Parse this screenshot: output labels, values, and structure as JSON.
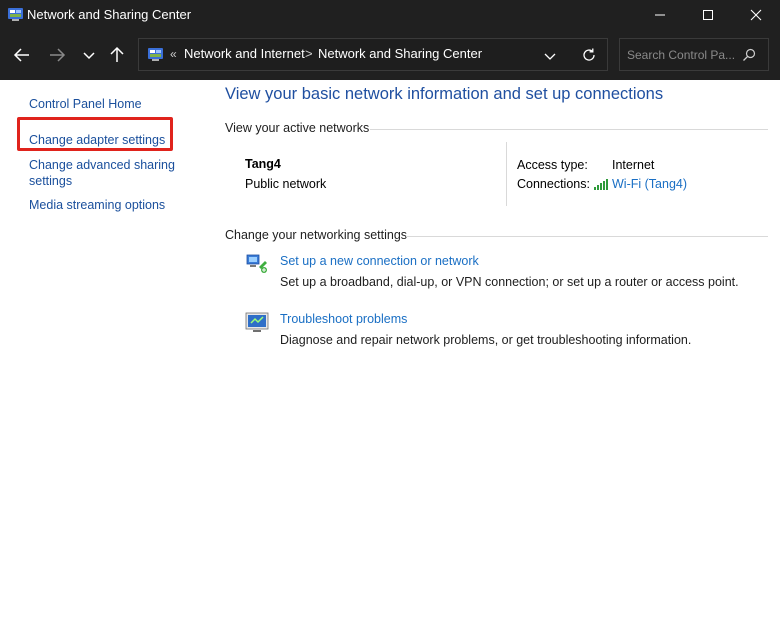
{
  "window": {
    "title": "Network and Sharing Center",
    "controls": [
      "minimize-icon",
      "maximize-icon",
      "close-icon"
    ]
  },
  "navigation": {
    "back_icon": "arrow-left-icon",
    "forward_icon": "arrow-right-icon",
    "recent_icon": "chevron-down-icon",
    "up_icon": "arrow-up-icon",
    "address": {
      "separator": "«",
      "crumbs": [
        "Network and Internet",
        "Network and Sharing Center"
      ],
      "crumb_separator": ">",
      "dropdown_icon": "chevron-down-icon",
      "refresh_icon": "refresh-icon"
    },
    "search": {
      "placeholder": "Search Control Pa...",
      "value": ""
    }
  },
  "sidebar": {
    "items": [
      {
        "label": "Control Panel Home"
      },
      {
        "label": "Change adapter settings",
        "highlighted": true
      },
      {
        "label": "Change advanced sharing settings"
      },
      {
        "label": "Media streaming options"
      }
    ],
    "highlight_color": "#e0231c"
  },
  "main": {
    "title": "View your basic network information and set up connections",
    "active_networks": {
      "heading": "View your active networks",
      "network_name": "Tang4",
      "network_type": "Public network",
      "access_type_label": "Access type:",
      "access_type_value": "Internet",
      "connections_label": "Connections:",
      "connections_value": "Wi-Fi (Tang4)"
    },
    "settings": {
      "heading": "Change your networking settings",
      "tasks": [
        {
          "link": "Set up a new connection or network",
          "description": "Set up a broadband, dial-up, or VPN connection; or set up a router or access point.",
          "icon": "new-connection-icon"
        },
        {
          "link": "Troubleshoot problems",
          "description": "Diagnose and repair network problems, or get troubleshooting information.",
          "icon": "troubleshoot-icon"
        }
      ]
    }
  },
  "colors": {
    "titlebar_bg": "#202020",
    "link_blue": "#1a6fc4",
    "title_blue": "#1f4fa0",
    "sidebar_link": "#1a4f9c"
  }
}
